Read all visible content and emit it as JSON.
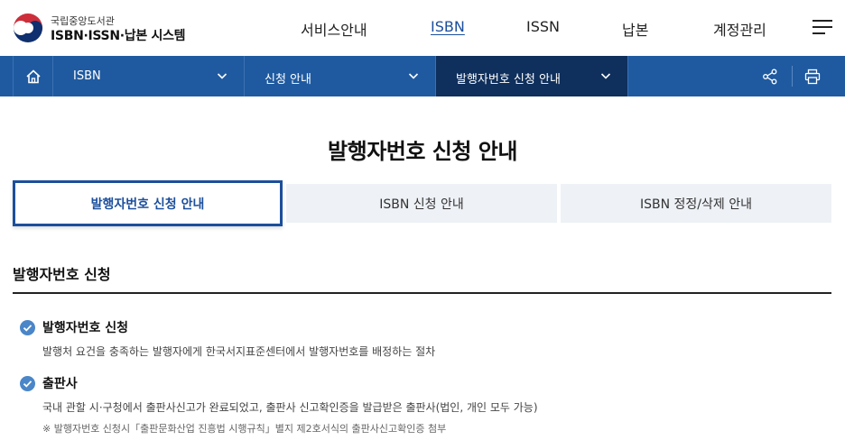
{
  "header": {
    "org_name": "국립중앙도서관",
    "system_name": "ISBN·ISSN·납본 시스템",
    "menu": [
      {
        "label": "서비스안내",
        "active": false
      },
      {
        "label": "ISBN",
        "active": true
      },
      {
        "label": "ISSN",
        "active": false
      },
      {
        "label": "납본",
        "active": false
      },
      {
        "label": "계정관리",
        "active": false
      }
    ],
    "hamburger_icon": "hamburger-menu-icon"
  },
  "navbar": {
    "home_icon": "home-icon",
    "segments": [
      {
        "label": "ISBN"
      },
      {
        "label": "신청 안내"
      },
      {
        "label": "발행자번호 신청 안내"
      }
    ],
    "share_icon": "share-icon",
    "print_icon": "print-icon"
  },
  "page": {
    "title": "발행자번호 신청 안내"
  },
  "tabs": [
    {
      "label": "발행자번호 신청 안내",
      "active": true
    },
    {
      "label": "ISBN 신청 안내",
      "active": false
    },
    {
      "label": "ISBN 정정/삭제 안내",
      "active": false
    }
  ],
  "section": {
    "title": "발행자번호 신청",
    "items": [
      {
        "heading": "발행자번호 신청",
        "description": "발행처 요건을 충족하는 발행자에게 한국서지표준센터에서 발행자번호를 배정하는 절차"
      },
      {
        "heading": "출판사",
        "description": "국내 관할 시·구청에서 출판사신고가 완료되었고, 출판사 신고확인증을 발급받은 출판사(법인, 개인 모두 가능)",
        "note": "※ 발행자번호 신청시「출판문화산업 진흥법 시행규칙」별지 제2호서식의 출판사신고확인증 첨부"
      }
    ]
  },
  "colors": {
    "navbar_bg": "#1f5aa0",
    "navbar_current_bg": "#0f2f5c",
    "accent": "#1c4f9c",
    "check": "#4a86c8",
    "tab_bg": "#eef1f6"
  }
}
